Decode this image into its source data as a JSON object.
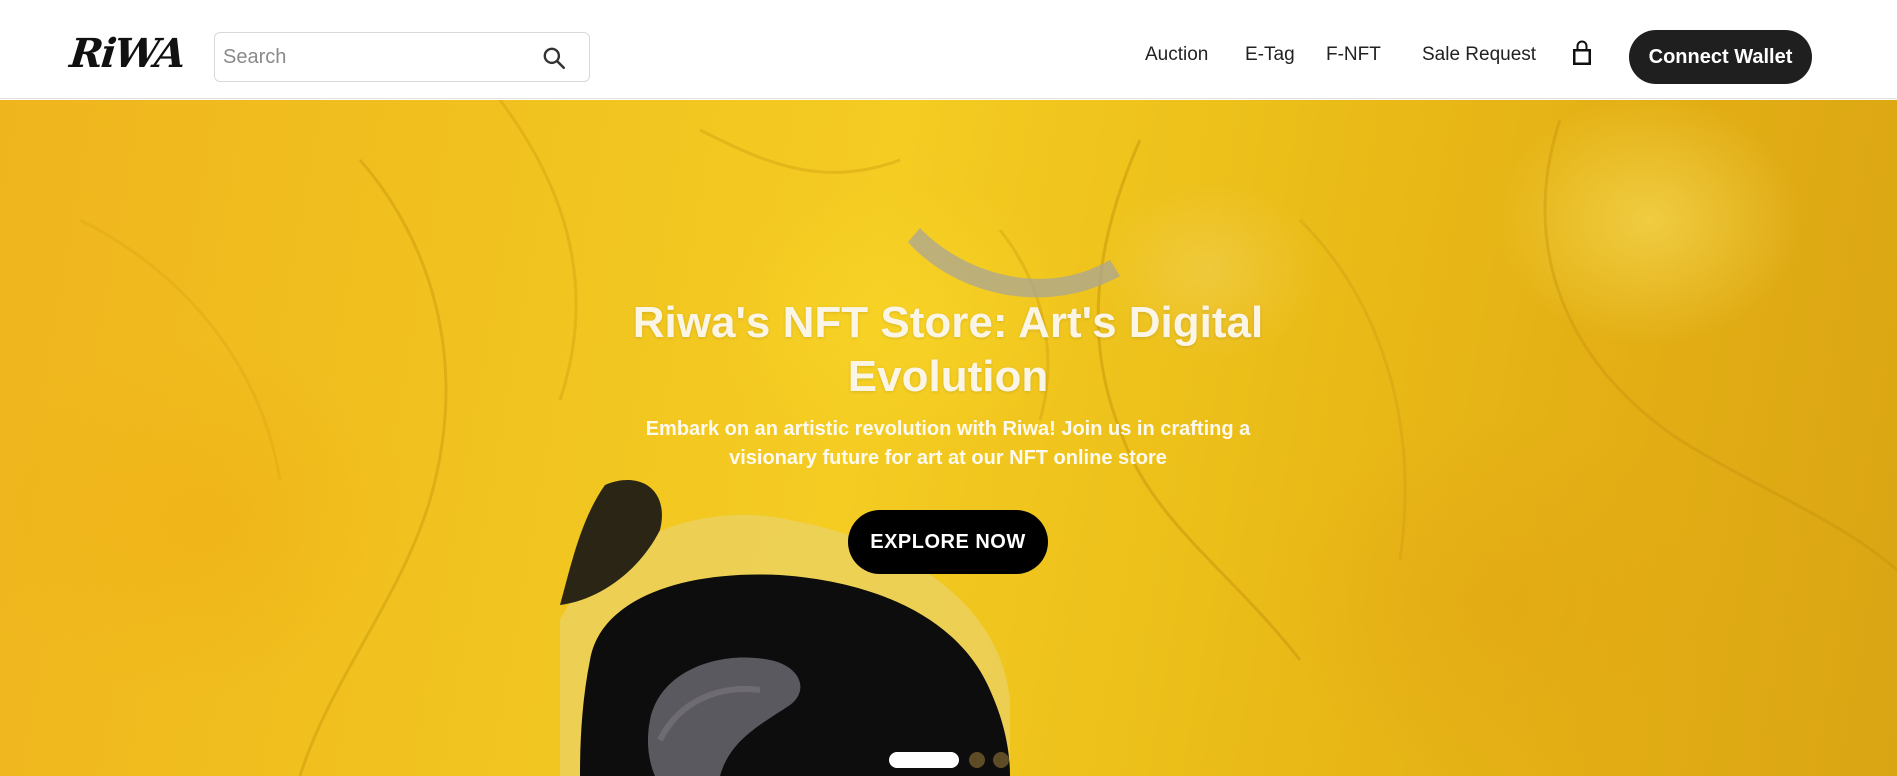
{
  "header": {
    "logo_text": "RiWA",
    "search": {
      "placeholder": "Search",
      "value": ""
    },
    "nav": [
      {
        "label": "Auction"
      },
      {
        "label": "E-Tag"
      },
      {
        "label": "F-NFT"
      },
      {
        "label": "Sale Request"
      }
    ],
    "cart_icon": "shopping-bag-icon",
    "connect_label": "Connect Wallet"
  },
  "hero": {
    "title": "Riwa's NFT Store: Art's Digital Evolution",
    "subtitle": "Embark on an artistic revolution with Riwa! Join us in crafting a visionary future for art at our NFT online store",
    "cta_label": "EXPLORE NOW",
    "slides": {
      "count": 3,
      "active": 1
    }
  },
  "colors": {
    "brand_dark": "#1f1f1f",
    "hero_yellow": "#f1c21f",
    "hero_text": "#fbf5e6"
  }
}
